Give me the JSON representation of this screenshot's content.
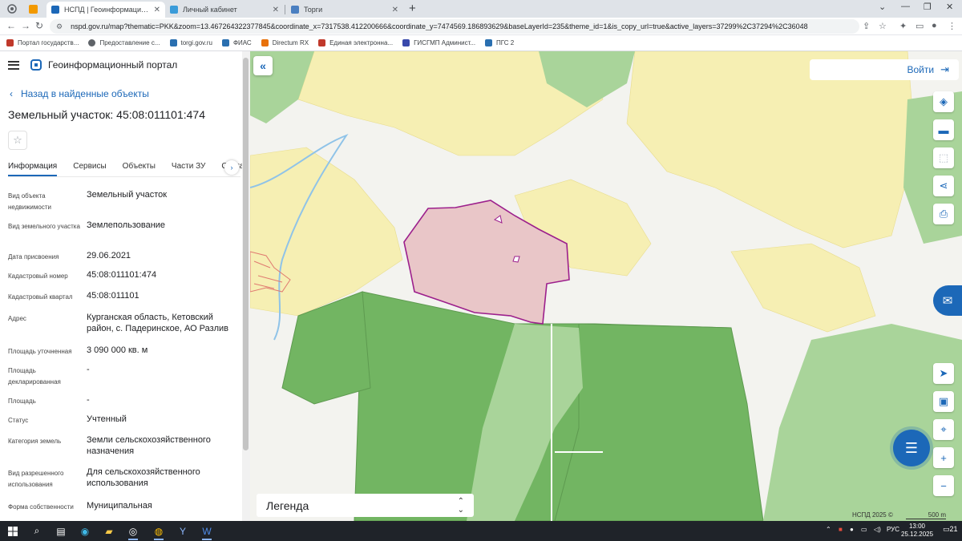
{
  "browser": {
    "tabs": [
      {
        "label": "НСПД | Геоинформационный п",
        "active": true
      },
      {
        "label": "Личный кабинет",
        "active": false
      },
      {
        "label": "Торги",
        "active": false
      }
    ],
    "url": "nspd.gov.ru/map?thematic=PKK&zoom=13.467264322377845&coordinate_x=7317538.412200666&coordinate_y=7474569.186893629&baseLayerId=235&theme_id=1&is_copy_url=true&active_layers=37299%2C37294%2C36048",
    "bookmarks": [
      "Портал государств...",
      "Предоставление с...",
      "torgi.gov.ru",
      "ФИАС",
      "Directum RX",
      "Единая электронна...",
      "ГИСГМП Админист...",
      "ПГС 2"
    ]
  },
  "app": {
    "title": "Геоинформационный портал",
    "back_label": "Назад в найденные объекты",
    "object_title": "Земельный участок: 45:08:011101:474",
    "tabs": [
      "Информация",
      "Сервисы",
      "Объекты",
      "Части ЗУ",
      "Соста"
    ],
    "fields": [
      {
        "label": "Вид объекта недвижимости",
        "value": "Земельный участок"
      },
      {
        "label": "Вид земельного участка",
        "value": "Землепользование"
      },
      {
        "label": "Дата присвоения",
        "value": "29.06.2021"
      },
      {
        "label": "Кадастровый номер",
        "value": "45:08:011101:474"
      },
      {
        "label": "Кадастровый квартал",
        "value": "45:08:011101"
      },
      {
        "label": "Адрес",
        "value": "Курганская область, Кетовский район, с. Падеринское, АО Разлив"
      },
      {
        "label": "Площадь уточненная",
        "value": "3 090 000 кв. м"
      },
      {
        "label": "Площадь декларированная",
        "value": "-"
      },
      {
        "label": "Площадь",
        "value": "-"
      },
      {
        "label": "Статус",
        "value": "Учтенный"
      },
      {
        "label": "Категория земель",
        "value": "Земли сельскохозяйственного назначения"
      },
      {
        "label": "Вид разрешенного использования",
        "value": "Для сельскохозяйственного использования"
      },
      {
        "label": "Форма собственности",
        "value": "Муниципальная"
      }
    ]
  },
  "map": {
    "login_label": "Войти",
    "legend_label": "Легенда",
    "attribution": "НСПД 2025 ©",
    "scale_label": "500 m"
  },
  "taskbar": {
    "language": "РУС",
    "time": "13:00",
    "date": "25.12.2025",
    "notifications": "21"
  },
  "colors": {
    "accent": "#1c68b8",
    "parcel_fill": "#e9c6c8",
    "parcel_stroke": "#9c1f8c",
    "forest_dark": "#72b562",
    "forest_light": "#a9d49a",
    "field_yellow": "#f6efb3"
  }
}
